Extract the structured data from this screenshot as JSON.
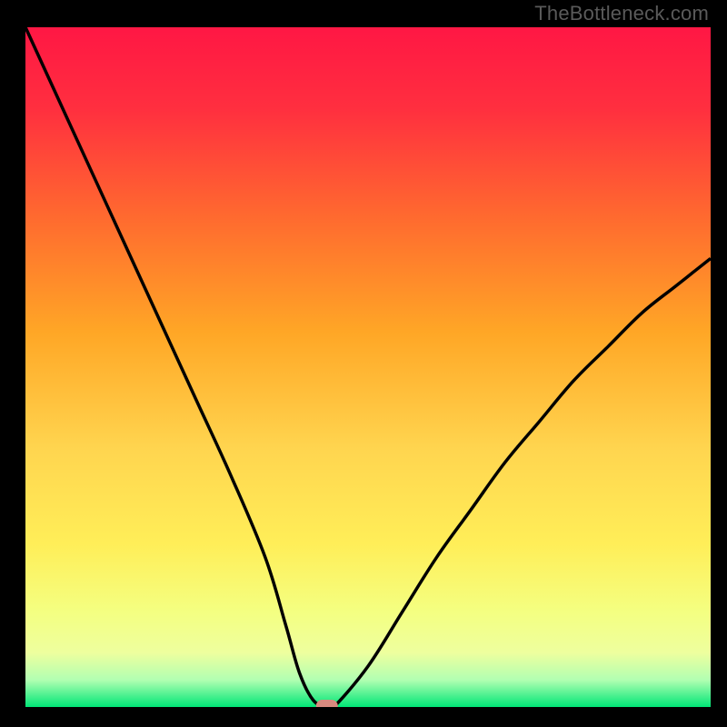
{
  "attribution": "TheBottleneck.com",
  "colors": {
    "frame": "#000000",
    "curve": "#000000",
    "marker_fill": "#d88a7f",
    "gradient_stops": [
      {
        "offset": 0.0,
        "color": "#ff1744"
      },
      {
        "offset": 0.12,
        "color": "#ff2f3f"
      },
      {
        "offset": 0.28,
        "color": "#ff6a2f"
      },
      {
        "offset": 0.45,
        "color": "#ffa726"
      },
      {
        "offset": 0.62,
        "color": "#ffd54f"
      },
      {
        "offset": 0.76,
        "color": "#ffee58"
      },
      {
        "offset": 0.86,
        "color": "#f4ff81"
      },
      {
        "offset": 0.92,
        "color": "#eeff9e"
      },
      {
        "offset": 0.96,
        "color": "#b2ffb2"
      },
      {
        "offset": 1.0,
        "color": "#00e676"
      }
    ]
  },
  "chart_data": {
    "type": "line",
    "title": "",
    "xlabel": "",
    "ylabel": "",
    "xlim": [
      0,
      100
    ],
    "ylim": [
      0,
      100
    ],
    "series": [
      {
        "name": "bottleneck-curve",
        "x": [
          0,
          5,
          10,
          15,
          20,
          25,
          30,
          35,
          38,
          40,
          42,
          44,
          45,
          50,
          55,
          60,
          65,
          70,
          75,
          80,
          85,
          90,
          95,
          100
        ],
        "y": [
          100,
          89,
          78,
          67,
          56,
          45,
          34,
          22,
          12,
          5,
          1,
          0,
          0,
          6,
          14,
          22,
          29,
          36,
          42,
          48,
          53,
          58,
          62,
          66
        ]
      }
    ],
    "marker": {
      "x": 44,
      "y": 0
    }
  }
}
